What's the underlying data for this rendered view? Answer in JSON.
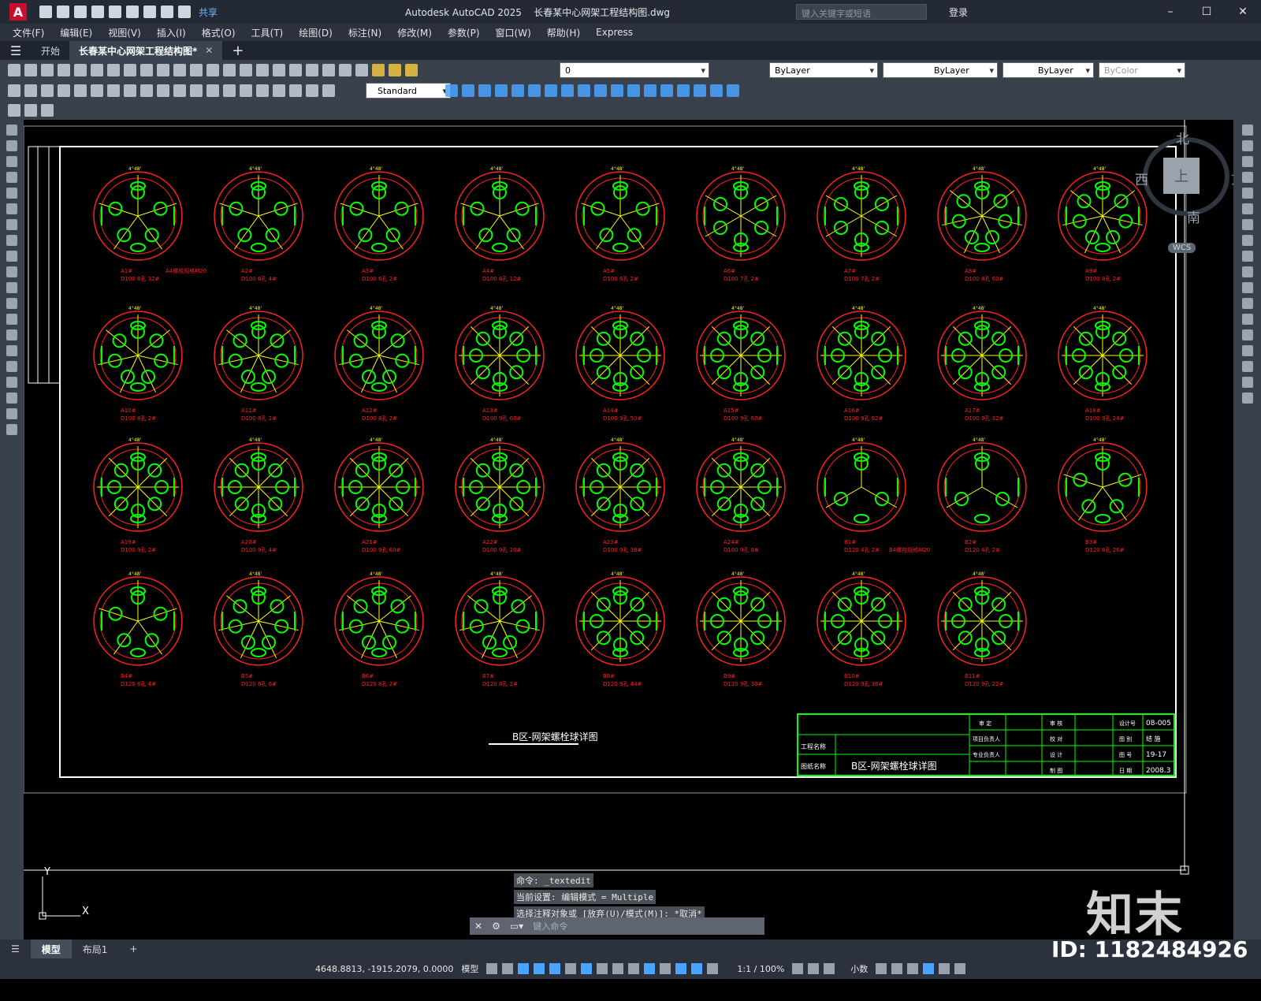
{
  "app": {
    "title": "Autodesk AutoCAD 2025",
    "file": "长春某中心网架工程结构图.dwg",
    "share": "共享",
    "search_placeholder": "键入关键字或短语",
    "login": "登录"
  },
  "menu": [
    "文件(F)",
    "编辑(E)",
    "视图(V)",
    "插入(I)",
    "格式(O)",
    "工具(T)",
    "绘图(D)",
    "标注(N)",
    "修改(M)",
    "参数(P)",
    "窗口(W)",
    "帮助(H)",
    "Express"
  ],
  "tabs": {
    "start": "开始",
    "doc": "长春某中心网架工程结构图*"
  },
  "toolbar": {
    "layer": "0",
    "color": "ByLayer",
    "linetype": "ByLayer",
    "lineweight": "ByLayer",
    "plotstyle": "ByColor",
    "text_style": "Standard"
  },
  "viewcube": {
    "north": "北",
    "south": "南",
    "east": "东",
    "west": "西",
    "top": "上",
    "wcs": "WCS"
  },
  "drawing": {
    "title": "B区-网架螺栓球详图",
    "note_a1": "A4螺栓规格M20",
    "note_b1": "B4螺栓规格M20",
    "angle_label": "4°48'",
    "balls": [
      {
        "id": "A1#",
        "size": "D100 6孔 32#"
      },
      {
        "id": "A2#",
        "size": "D100 6孔 4#"
      },
      {
        "id": "A3#",
        "size": "D100 6孔 2#"
      },
      {
        "id": "A4#",
        "size": "D100 6孔 12#"
      },
      {
        "id": "A5#",
        "size": "D100 6孔 2#"
      },
      {
        "id": "A6#",
        "size": "D100 7孔 2#"
      },
      {
        "id": "A7#",
        "size": "D100 7孔 2#"
      },
      {
        "id": "A8#",
        "size": "D100 8孔 60#"
      },
      {
        "id": "A9#",
        "size": "D100 8孔 2#"
      },
      {
        "id": "A10#",
        "size": "D100 8孔 2#"
      },
      {
        "id": "A11#",
        "size": "D100 8孔 2#"
      },
      {
        "id": "A12#",
        "size": "D100 8孔 2#"
      },
      {
        "id": "A13#",
        "size": "D100 9孔 60#"
      },
      {
        "id": "A14#",
        "size": "D100 9孔 50#"
      },
      {
        "id": "A15#",
        "size": "D100 9孔 60#"
      },
      {
        "id": "A16#",
        "size": "D100 9孔 92#"
      },
      {
        "id": "A17#",
        "size": "D100 9孔 32#"
      },
      {
        "id": "A18#",
        "size": "D100 9孔 24#"
      },
      {
        "id": "A19#",
        "size": "D100 9孔 2#"
      },
      {
        "id": "A20#",
        "size": "D100 9孔 4#"
      },
      {
        "id": "A21#",
        "size": "D100 9孔 60#"
      },
      {
        "id": "A22#",
        "size": "D100 9孔 20#"
      },
      {
        "id": "A23#",
        "size": "D100 9孔 38#"
      },
      {
        "id": "A24#",
        "size": "D100 9孔 8#"
      },
      {
        "id": "B1#",
        "size": "D120 4孔 2#"
      },
      {
        "id": "B2#",
        "size": "D120 4孔 2#"
      },
      {
        "id": "B3#",
        "size": "D120 6孔 26#"
      },
      {
        "id": "B4#",
        "size": "D120 6孔 4#"
      },
      {
        "id": "B5#",
        "size": "D120 8孔 6#"
      },
      {
        "id": "B6#",
        "size": "D120 8孔 2#"
      },
      {
        "id": "B7#",
        "size": "D120 8孔 2#"
      },
      {
        "id": "B8#",
        "size": "D120 9孔 44#"
      },
      {
        "id": "B9#",
        "size": "D120 9孔 30#"
      },
      {
        "id": "B10#",
        "size": "D120 9孔 36#"
      },
      {
        "id": "B11#",
        "size": "D120 9孔 22#"
      }
    ],
    "title_block": {
      "project_label": "工程名称",
      "drawing_label": "图纸名称",
      "drawing_name": "B区-网架螺栓球详图",
      "c1": [
        "审 定",
        "项目负责人",
        "专业负责人"
      ],
      "c2": [
        "审 核",
        "校 对",
        "设 计",
        "制 图"
      ],
      "c3": [
        "设计号",
        "图 别",
        "图 号",
        "日 期"
      ],
      "c4": [
        "08-005",
        "结 施",
        "19-17",
        "2008.3"
      ]
    }
  },
  "command": {
    "history": [
      "命令: _textedit",
      "当前设置: 编辑模式 = Multiple",
      "选择注释对象或 [放弃(U)/模式(M)]: *取消*"
    ],
    "placeholder": "键入命令"
  },
  "layouts": [
    "模型",
    "布局1"
  ],
  "status": {
    "coords": "4648.8813, -1915.2079, 0.0000",
    "space": "模型",
    "scale": "1:1 / 100%",
    "units": "小数"
  },
  "watermark": {
    "brand": "知末",
    "id": "ID: 1182484926"
  },
  "colors": {
    "ball": "#ff2020",
    "hole": "#00ff00",
    "axis": "#ffff00",
    "frame": "#ffffff",
    "titleblock": "#00ff00"
  }
}
